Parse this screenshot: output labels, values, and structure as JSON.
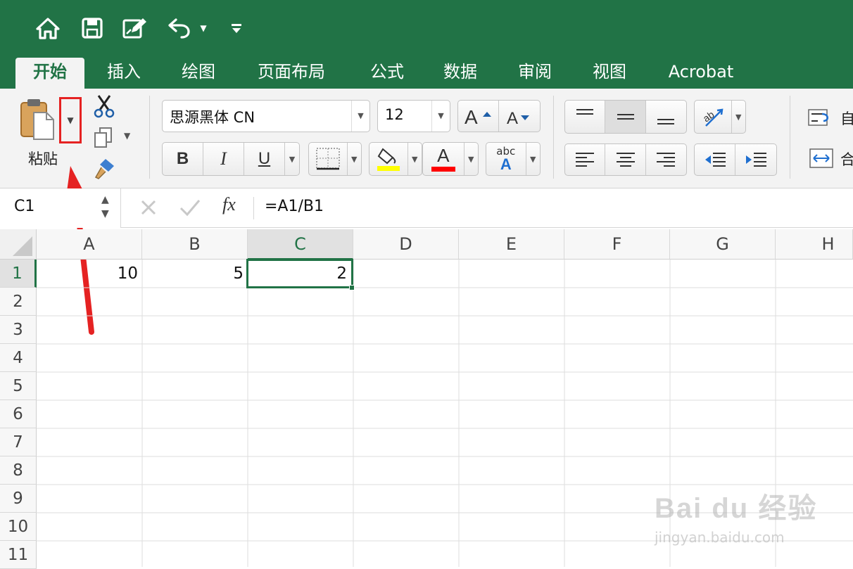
{
  "app": {
    "accent": "#217346"
  },
  "qat": {
    "icons": [
      "home-icon",
      "save-icon",
      "edit-icon",
      "undo-icon",
      "customize-icon"
    ]
  },
  "tabs": [
    "开始",
    "插入",
    "绘图",
    "页面布局",
    "公式",
    "数据",
    "审阅",
    "视图",
    "Acrobat"
  ],
  "ribbon": {
    "paste_label": "粘贴",
    "font_name": "思源黑体 CN",
    "font_size": "12",
    "wrap_label": "自",
    "merge_label": "合",
    "abc_label": "abc",
    "bold": "B",
    "italic": "I",
    "underline": "U",
    "font_color_letter": "A",
    "fill_color": "#ffff00",
    "font_color": "#ff0000"
  },
  "formula_bar": {
    "name_box": "C1",
    "fx": "fx",
    "formula": "=A1/B1"
  },
  "sheet": {
    "columns": [
      "A",
      "B",
      "C",
      "D",
      "E",
      "F",
      "G",
      "H"
    ],
    "rows": [
      "1",
      "2",
      "3",
      "4",
      "5",
      "6",
      "7",
      "8",
      "9",
      "10",
      "11"
    ],
    "selected_cell": "C1",
    "row1": {
      "A": "10",
      "B": "5",
      "C": "2"
    }
  },
  "annotation": {
    "highlight_color": "#e52222"
  },
  "watermark": {
    "brand": "Bai du 经验",
    "url": "jingyan.baidu.com"
  }
}
